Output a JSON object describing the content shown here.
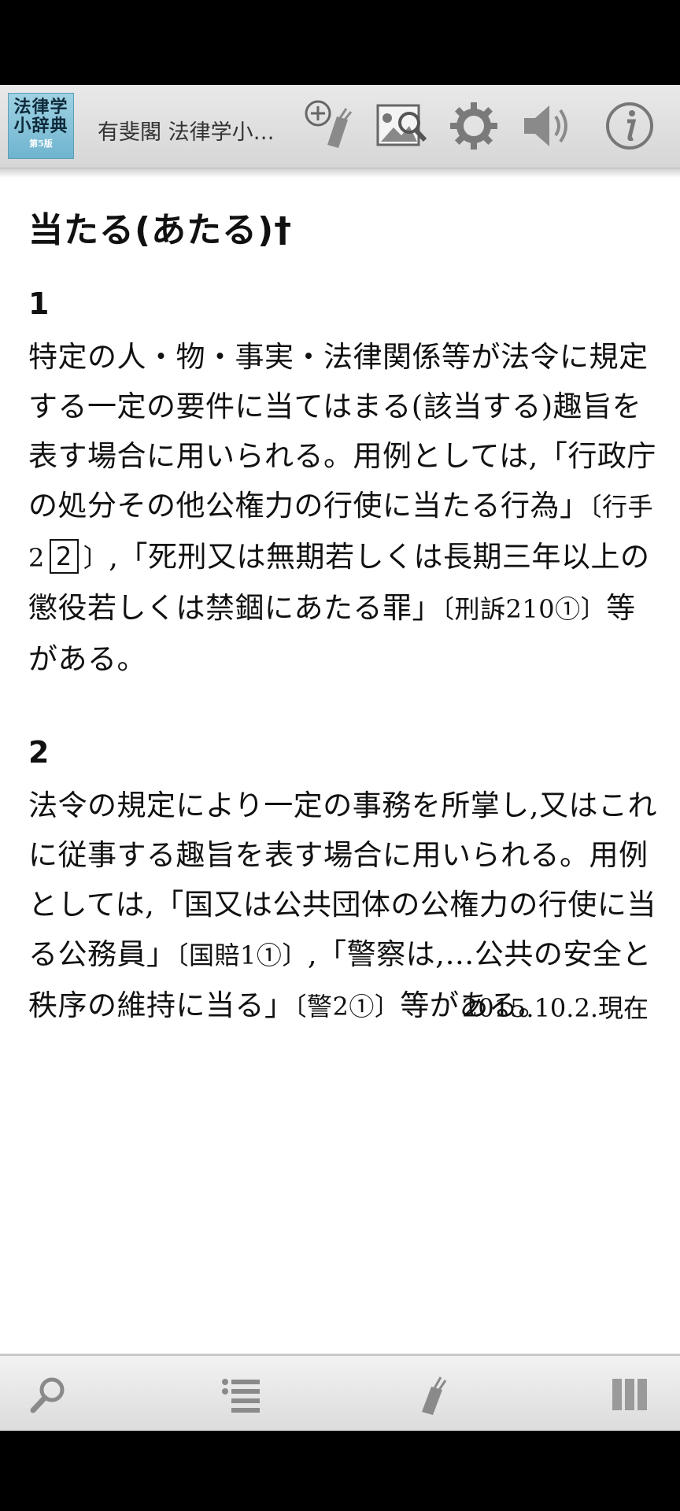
{
  "app": {
    "logo_lines": [
      "法律学",
      "小辞典"
    ],
    "logo_edition": "第5版",
    "title": "有斐閣 法律学小…"
  },
  "toolbar": {
    "icons": [
      "add-bookmark-icon",
      "image-search-icon",
      "gear-icon",
      "speaker-icon",
      "info-icon"
    ]
  },
  "entry": {
    "title": "当たる(あたる)†",
    "sections": [
      {
        "number": "1",
        "text_parts": {
          "a": "特定の人・物・事実・法律関係等が法令に規定する一定の要件に当てはまる(該当する)趣旨を表す場合に用いられる。用例としては,「行政庁の処分その他公権力の行使に当たる行為」",
          "ref1_open": "〔行手2",
          "ref1_box": "2",
          "ref1_close": "〕",
          "b": ",「死刑又は無期若しくは長期三年以上の懲役若しくは禁錮にあたる罪」",
          "ref2": "〔刑訴210①〕",
          "c": "等がある。"
        }
      },
      {
        "number": "2",
        "text_parts": {
          "a": "法令の規定により一定の事務を所掌し,又はこれに従事する趣旨を表す場合に用いられる。用例としては,「国又は公共団体の公権力の行使に当る公務員」",
          "ref1": "〔国賠1①〕",
          "b": ",「警察は,…公共の安全と秩序の維持に当る」",
          "ref2": "〔警2①〕",
          "c": "等がある。"
        }
      }
    ],
    "date_note": "2015.10.2.現在"
  },
  "bottom_bar": {
    "icons": [
      "search-icon",
      "list-icon",
      "bookmark-icon",
      "columns-icon"
    ]
  }
}
